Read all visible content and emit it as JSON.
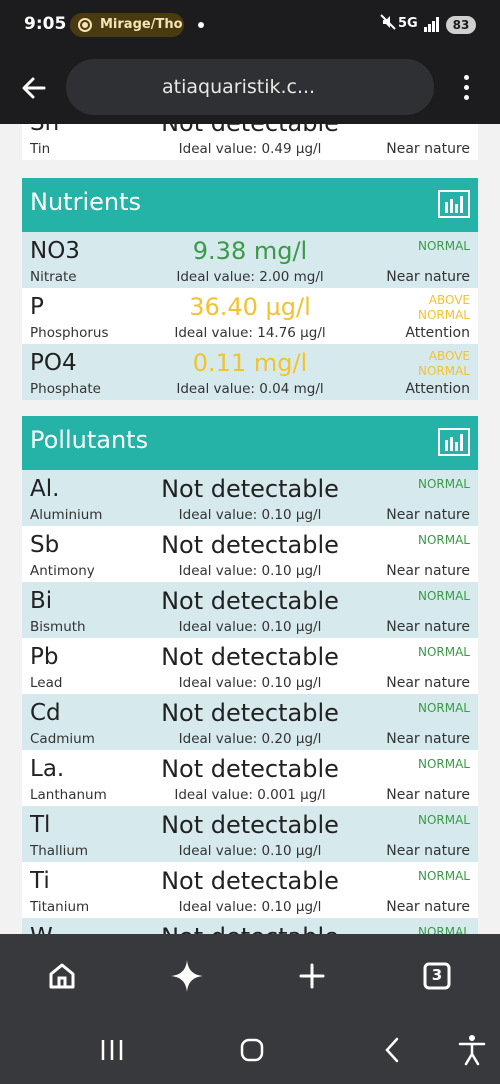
{
  "status_bar": {
    "time": "9:05",
    "recording_label": "Mirage/Tho",
    "network": "5G",
    "battery": "83"
  },
  "browser": {
    "url": "atiaquaristik.c...",
    "tab_count": "3"
  },
  "tin_row": {
    "symbol": "Sn",
    "name": "Tin",
    "value": "Not detectable",
    "ideal": "Ideal value: 0.49 µg/l",
    "assessment": "Near nature"
  },
  "nutrients": {
    "title": "Nutrients",
    "rows": [
      {
        "symbol": "NO3",
        "name": "Nitrate",
        "value": "9.38 mg/l",
        "ideal": "Ideal value: 2.00 mg/l",
        "status": "NORMAL",
        "assessment": "Near nature"
      },
      {
        "symbol": "P",
        "name": "Phosphorus",
        "value": "36.40 µg/l",
        "ideal": "Ideal value: 14.76 µg/l",
        "status_line1": "ABOVE",
        "status_line2": "NORMAL",
        "assessment": "Attention"
      },
      {
        "symbol": "PO4",
        "name": "Phosphate",
        "value": "0.11 mg/l",
        "ideal": "Ideal value: 0.04 mg/l",
        "status_line1": "ABOVE",
        "status_line2": "NORMAL",
        "assessment": "Attention"
      }
    ]
  },
  "pollutants": {
    "title": "Pollutants",
    "rows": [
      {
        "symbol": "Al.",
        "name": "Aluminium",
        "value": "Not detectable",
        "ideal": "Ideal value: 0.10 µg/l",
        "status": "NORMAL",
        "assessment": "Near nature"
      },
      {
        "symbol": "Sb",
        "name": "Antimony",
        "value": "Not detectable",
        "ideal": "Ideal value: 0.10 µg/l",
        "status": "NORMAL",
        "assessment": "Near nature"
      },
      {
        "symbol": "Bi",
        "name": "Bismuth",
        "value": "Not detectable",
        "ideal": "Ideal value: 0.10 µg/l",
        "status": "NORMAL",
        "assessment": "Near nature"
      },
      {
        "symbol": "Pb",
        "name": "Lead",
        "value": "Not detectable",
        "ideal": "Ideal value: 0.10 µg/l",
        "status": "NORMAL",
        "assessment": "Near nature"
      },
      {
        "symbol": "Cd",
        "name": "Cadmium",
        "value": "Not detectable",
        "ideal": "Ideal value: 0.20 µg/l",
        "status": "NORMAL",
        "assessment": "Near nature"
      },
      {
        "symbol": "La.",
        "name": "Lanthanum",
        "value": "Not detectable",
        "ideal": "Ideal value: 0.001 µg/l",
        "status": "NORMAL",
        "assessment": "Near nature"
      },
      {
        "symbol": "Tl",
        "name": "Thallium",
        "value": "Not detectable",
        "ideal": "Ideal value: 0.10 µg/l",
        "status": "NORMAL",
        "assessment": "Near nature"
      },
      {
        "symbol": "Ti",
        "name": "Titanium",
        "value": "Not detectable",
        "ideal": "Ideal value: 0.10 µg/l",
        "status": "NORMAL",
        "assessment": "Near nature"
      },
      {
        "symbol": "W",
        "name": "",
        "value": "Not detectable",
        "ideal": "",
        "status": "NORMAL",
        "assessment": ""
      }
    ]
  },
  "colors": {
    "header_teal": "#24b3a6",
    "row_alt": "#d6eaee",
    "normal_green": "#3a9a48",
    "above_yellow": "#f2c230"
  },
  "icons": {
    "back": "arrow-left-icon",
    "menu": "more-vert-icon",
    "chart": "bar-chart-icon",
    "home": "home-icon",
    "sparkle": "sparkle-icon",
    "new_tab": "plus-icon",
    "tabs": "tab-switcher-icon"
  }
}
